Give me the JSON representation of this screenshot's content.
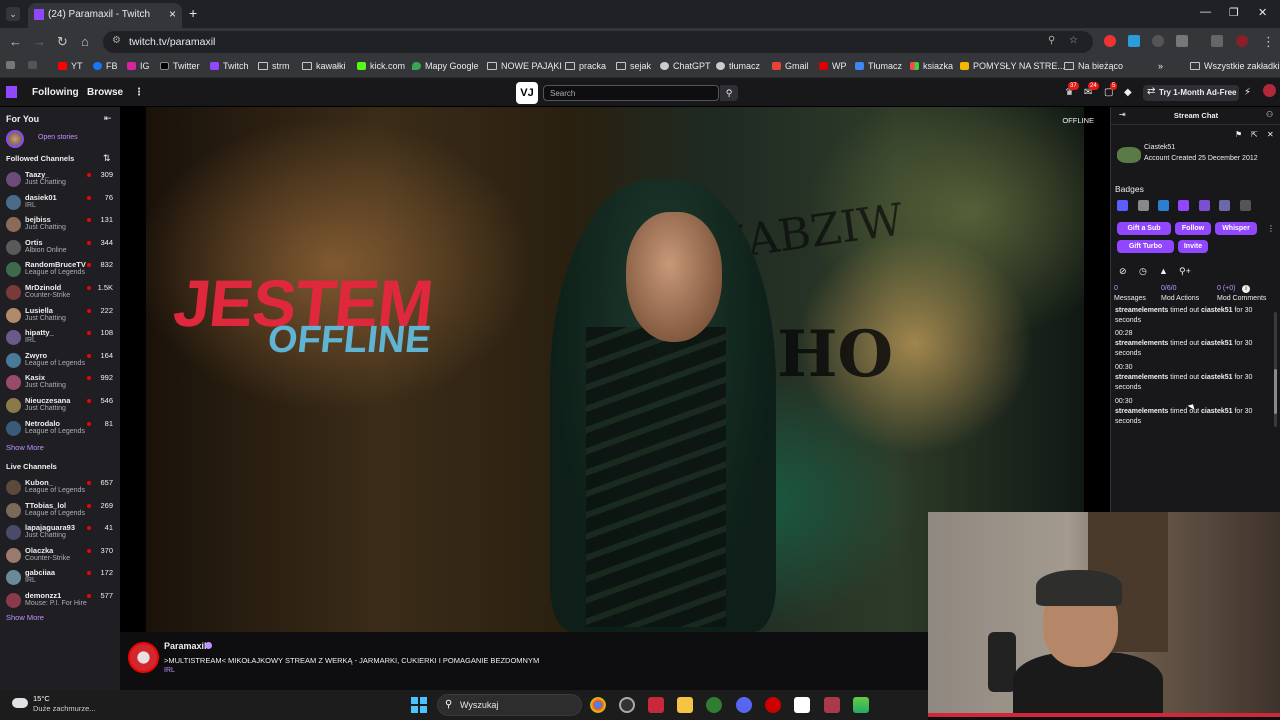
{
  "browser": {
    "tab_title": "(24) Paramaxil - Twitch",
    "url": "twitch.tv/paramaxil",
    "bookmarks": [
      "YT",
      "FB",
      "IG",
      "Twitter",
      "Twitch",
      "strm",
      "kawałki",
      "kick.com",
      "Mapy Google",
      "NOWE PAJĄKI",
      "pracka",
      "sejak",
      "ChatGPT",
      "tłumacz",
      "Gmail",
      "WP",
      "Tłumacz",
      "ksiazka",
      "POMYSŁY NA STRE...",
      "Na bieżąco",
      "Wszystkie zakładki"
    ]
  },
  "twitch_nav": {
    "following": "Following",
    "browse": "Browse",
    "search_placeholder": "Search",
    "vj_logo": "VJ",
    "notif_counts": [
      "37",
      "24",
      "5"
    ],
    "ad_free": "Try 1-Month Ad-Free"
  },
  "sidebar": {
    "for_you": "For You",
    "open_stories": "Open stories",
    "followed_title": "Followed Channels",
    "followed": [
      {
        "name": "Taazy_",
        "game": "Just Chatting",
        "viewers": "309",
        "color": "#6b4b7a"
      },
      {
        "name": "dasiek01",
        "game": "IRL",
        "viewers": "76",
        "color": "#4a6b8a"
      },
      {
        "name": "bejbiss",
        "game": "Just Chatting",
        "viewers": "131",
        "color": "#8a6b5a"
      },
      {
        "name": "Ortis",
        "game": "Albion Online",
        "viewers": "344",
        "color": "#5a5a5a"
      },
      {
        "name": "RandomBruceTV",
        "game": "League of Legends",
        "viewers": "832",
        "color": "#3e6b4a"
      },
      {
        "name": "MrDzinold",
        "game": "Counter-Strike",
        "viewers": "1.5K",
        "color": "#7a3a3a"
      },
      {
        "name": "Lusiella",
        "game": "Just Chatting",
        "viewers": "222",
        "color": "#b08a6a"
      },
      {
        "name": "hipatty_",
        "game": "IRL",
        "viewers": "108",
        "color": "#6a5a8a"
      },
      {
        "name": "Zwyro",
        "game": "League of Legends",
        "viewers": "164",
        "color": "#4a7a9a"
      },
      {
        "name": "Kasix",
        "game": "Just Chatting",
        "viewers": "992",
        "color": "#9a4a6a"
      },
      {
        "name": "Nieuczesana",
        "game": "Just Chatting",
        "viewers": "546",
        "color": "#8a7a4a"
      },
      {
        "name": "Netrodalo",
        "game": "League of Legends",
        "viewers": "81",
        "color": "#3a5a7a"
      }
    ],
    "show_more_1": "Show More",
    "live_title": "Live Channels",
    "live": [
      {
        "name": "Kubon_",
        "game": "League of Legends",
        "viewers": "657",
        "color": "#5a4a3a"
      },
      {
        "name": "TTobias_lol",
        "game": "League of Legends",
        "viewers": "269",
        "color": "#7a6a5a"
      },
      {
        "name": "lapajaguara93",
        "game": "Just Chatting",
        "viewers": "41",
        "color": "#4a4a6a"
      },
      {
        "name": "Olaczka",
        "game": "Counter-Strike",
        "viewers": "370",
        "color": "#9a7a6a"
      },
      {
        "name": "gabciiaa",
        "game": "IRL",
        "viewers": "172",
        "color": "#6a8a9a"
      },
      {
        "name": "demonzz1",
        "game": "Mouse: P.I. For Hire",
        "viewers": "577",
        "color": "#8a3a4a"
      }
    ],
    "show_more_2": "Show More"
  },
  "player": {
    "offline_tag": "OFFLINE",
    "banner_line1": "JESTEM",
    "banner_line2": "OFFLINE",
    "graffiti": "ĆHO",
    "graffiti2": "ZABZIW"
  },
  "channel": {
    "name": "Paramaxil",
    "title": ">MULTISTREAM< MIKOŁAJKOWY STREAM Z WERKĄ - JARMARKI, CUKIERKI I POMAGANIE BEZDOMNYM",
    "category": "IRL"
  },
  "chat": {
    "header": "Stream Chat",
    "user_name": "Ciastek51",
    "account_created": "Account Created 25 December 2012",
    "badges_title": "Badges",
    "buttons": [
      "Gift a Sub",
      "Follow",
      "Whisper",
      "Gift Turbo",
      "Invite"
    ],
    "stats": [
      {
        "num": "0",
        "label": "Messages"
      },
      {
        "num": "0/6/0",
        "label": "Mod Actions"
      },
      {
        "num": "0 (+0)",
        "label": "Mod Comments"
      }
    ],
    "messages": [
      {
        "time": "",
        "actor": "streamelements",
        "text": " timed out ",
        "target": "ciastek51",
        "tail": " for 30 seconds"
      },
      {
        "time": "00:28",
        "actor": "streamelements",
        "text": " timed out ",
        "target": "ciastek51",
        "tail": " for 30 seconds"
      },
      {
        "time": "00:30",
        "actor": "streamelements",
        "text": " timed out ",
        "target": "ciastek51",
        "tail": " for 30 seconds"
      },
      {
        "time": "00:30",
        "actor": "streamelements",
        "text": " timed out ",
        "target": "ciastek51",
        "tail": " for 30 seconds"
      }
    ]
  },
  "taskbar": {
    "temp": "15°C",
    "weather": "Duże zachmurze...",
    "search": "Wyszukaj"
  },
  "colors": {
    "twitch_purple": "#9146ff",
    "live_red": "#eb0400",
    "link_purple": "#bf94ff"
  }
}
